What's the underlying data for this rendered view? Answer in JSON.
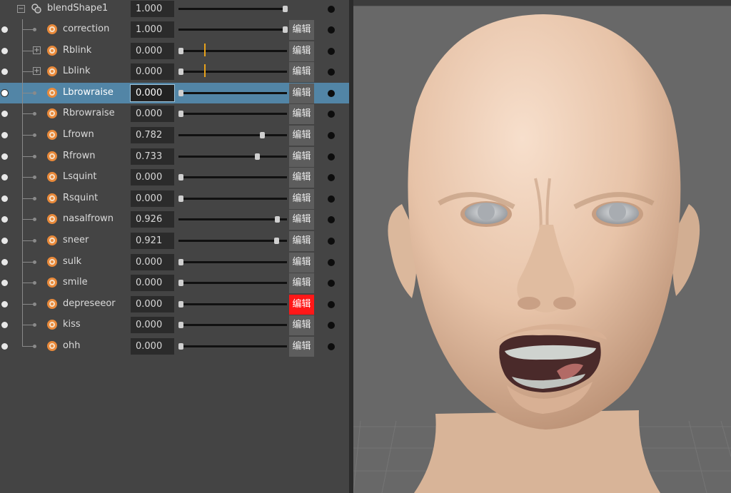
{
  "editor": {
    "edit_label": "编辑",
    "node": {
      "name": "blendShape1",
      "value": "1.000",
      "level": 1.0
    },
    "targets": [
      {
        "name": "correction",
        "value": "1.000",
        "level": 1.0,
        "expandable": false,
        "marker": null
      },
      {
        "name": "Rblink",
        "value": "0.000",
        "level": 0.0,
        "expandable": true,
        "marker": 0.24
      },
      {
        "name": "Lblink",
        "value": "0.000",
        "level": 0.0,
        "expandable": true,
        "marker": 0.24
      },
      {
        "name": "Lbrowraise",
        "value": "0.000",
        "level": 0.0,
        "expandable": false,
        "marker": null,
        "selected": true
      },
      {
        "name": "Rbrowraise",
        "value": "0.000",
        "level": 0.0,
        "expandable": false,
        "marker": null
      },
      {
        "name": "Lfrown",
        "value": "0.782",
        "level": 0.782,
        "expandable": false,
        "marker": null
      },
      {
        "name": "Rfrown",
        "value": "0.733",
        "level": 0.733,
        "expandable": false,
        "marker": null
      },
      {
        "name": "Lsquint",
        "value": "0.000",
        "level": 0.0,
        "expandable": false,
        "marker": null
      },
      {
        "name": "Rsquint",
        "value": "0.000",
        "level": 0.0,
        "expandable": false,
        "marker": null
      },
      {
        "name": "nasalfrown",
        "value": "0.926",
        "level": 0.926,
        "expandable": false,
        "marker": null
      },
      {
        "name": "sneer",
        "value": "0.921",
        "level": 0.921,
        "expandable": false,
        "marker": null
      },
      {
        "name": "sulk",
        "value": "0.000",
        "level": 0.0,
        "expandable": false,
        "marker": null
      },
      {
        "name": "smile",
        "value": "0.000",
        "level": 0.0,
        "expandable": false,
        "marker": null
      },
      {
        "name": "depreseeor",
        "value": "0.000",
        "level": 0.0,
        "expandable": false,
        "marker": null,
        "edit_active": true
      },
      {
        "name": "kiss",
        "value": "0.000",
        "level": 0.0,
        "expandable": false,
        "marker": null
      },
      {
        "name": "ohh",
        "value": "0.000",
        "level": 0.0,
        "expandable": false,
        "marker": null
      }
    ]
  },
  "colors": {
    "selected_row": "#5285a6",
    "edit_active": "#ff1818",
    "target_icon": "#e8893a",
    "skin": "#e9c9b0"
  },
  "icons": {
    "visibility": "visibility-dot-icon",
    "node": "blendshape-node-icon",
    "target": "target-shape-icon",
    "collapse": "collapse-minus-icon",
    "expand": "expand-plus-icon",
    "key": "key-dot-icon"
  }
}
